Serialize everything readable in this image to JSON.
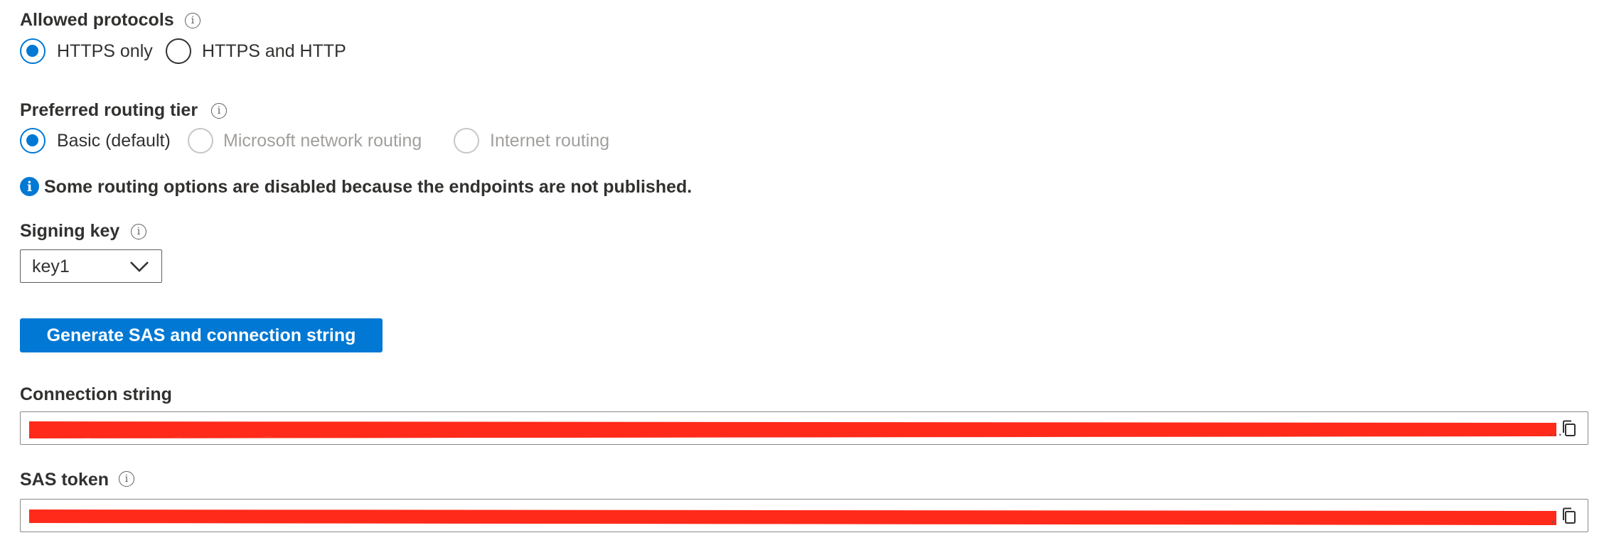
{
  "allowed_protocols": {
    "label": "Allowed protocols",
    "options": [
      {
        "label": "HTTPS only",
        "checked": true
      },
      {
        "label": "HTTPS and HTTP",
        "checked": false
      }
    ]
  },
  "routing_tier": {
    "label": "Preferred routing tier",
    "options": [
      {
        "label": "Basic (default)",
        "checked": true,
        "disabled": false
      },
      {
        "label": "Microsoft network routing",
        "checked": false,
        "disabled": true
      },
      {
        "label": "Internet routing",
        "checked": false,
        "disabled": true
      }
    ]
  },
  "notice": {
    "icon": "info-icon",
    "text": "Some routing options are disabled because the endpoints are not published."
  },
  "signing_key": {
    "label": "Signing key",
    "value": "key1"
  },
  "generate_button": {
    "label": "Generate SAS and connection string"
  },
  "connection_string": {
    "label": "Connection string",
    "value": "B",
    "ellipsis": "..."
  },
  "sas_token": {
    "label": "SAS token",
    "value": "?",
    "ellipsis": "."
  },
  "colors": {
    "accent": "#0078d4",
    "redaction": "#ff2a1a"
  }
}
